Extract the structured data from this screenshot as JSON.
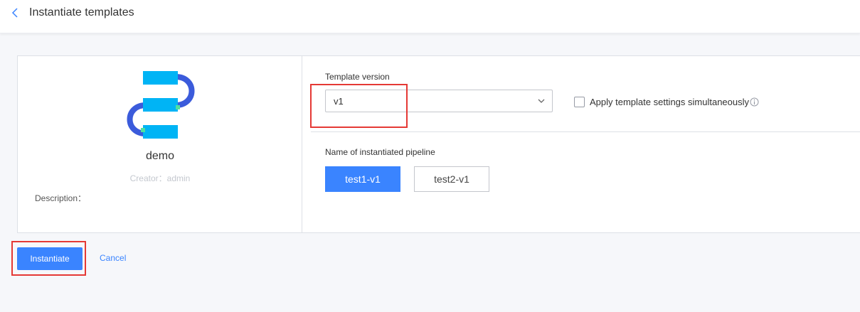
{
  "header": {
    "title": "Instantiate templates",
    "back_icon": "chevron-left-icon"
  },
  "template": {
    "name": "demo",
    "creator": "Creator：admin",
    "description": "Description：",
    "logo_icon": "pipeline-logo-icon"
  },
  "form": {
    "version_label": "Template version",
    "version_value": "v1",
    "apply_label": "Apply template settings simultaneously",
    "apply_checked": false,
    "pipeline_label": "Name of instantiated pipeline",
    "pipelines": [
      {
        "label": "test1-v1",
        "active": true
      },
      {
        "label": "test2-v1",
        "active": false
      }
    ]
  },
  "actions": {
    "instantiate_label": "Instantiate",
    "cancel_label": "Cancel"
  },
  "colors": {
    "accent": "#3a84ff",
    "highlight": "#e53935",
    "logo_bar": "#00b4f5",
    "logo_connector": "#3b5bdb",
    "logo_joint": "#4fe0a0"
  }
}
